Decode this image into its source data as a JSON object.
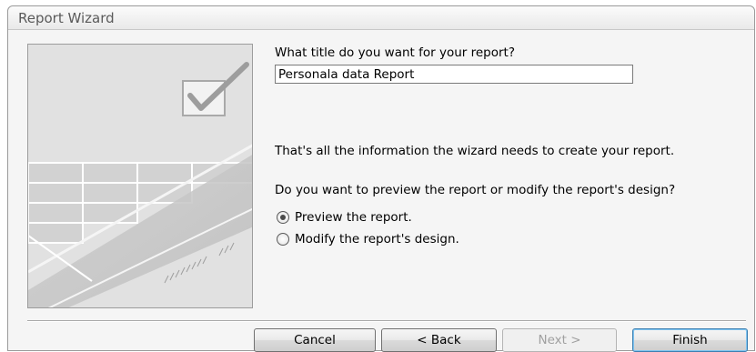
{
  "window": {
    "title": "Report Wizard"
  },
  "form": {
    "title_question": "What title do you want for your report?",
    "title_value": "Personala data Report",
    "info_text": "That's all the information the wizard needs to create your report.",
    "preview_question": "Do you want to preview the report or modify the report's design?",
    "options": [
      {
        "label": "Preview the report.",
        "selected": true
      },
      {
        "label": "Modify the report's design.",
        "selected": false
      }
    ]
  },
  "buttons": {
    "cancel": "Cancel",
    "back": "< Back",
    "next": "Next >",
    "finish": "Finish"
  }
}
